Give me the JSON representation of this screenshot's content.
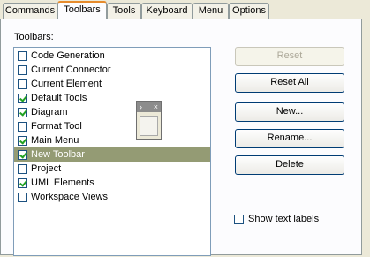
{
  "tabs": [
    {
      "label": "Commands"
    },
    {
      "label": "Toolbars",
      "active": true
    },
    {
      "label": "Tools"
    },
    {
      "label": "Keyboard"
    },
    {
      "label": "Menu"
    },
    {
      "label": "Options"
    }
  ],
  "toolbars_label": "Toolbars:",
  "toolbars": [
    {
      "label": "Code Generation",
      "checked": false
    },
    {
      "label": "Current Connector",
      "checked": false
    },
    {
      "label": "Current Element",
      "checked": false
    },
    {
      "label": "Default Tools",
      "checked": true
    },
    {
      "label": "Diagram",
      "checked": true
    },
    {
      "label": "Format Tool",
      "checked": false
    },
    {
      "label": "Main Menu",
      "checked": true
    },
    {
      "label": "New Toolbar",
      "checked": true,
      "selected": true
    },
    {
      "label": "Project",
      "checked": false
    },
    {
      "label": "UML Elements",
      "checked": true
    },
    {
      "label": "Workspace Views",
      "checked": false
    }
  ],
  "buttons": {
    "reset": "Reset",
    "reset_all": "Reset All",
    "new": "New...",
    "rename": "Rename...",
    "delete": "Delete"
  },
  "show_text_labels": {
    "label": "Show text labels",
    "checked": false
  }
}
